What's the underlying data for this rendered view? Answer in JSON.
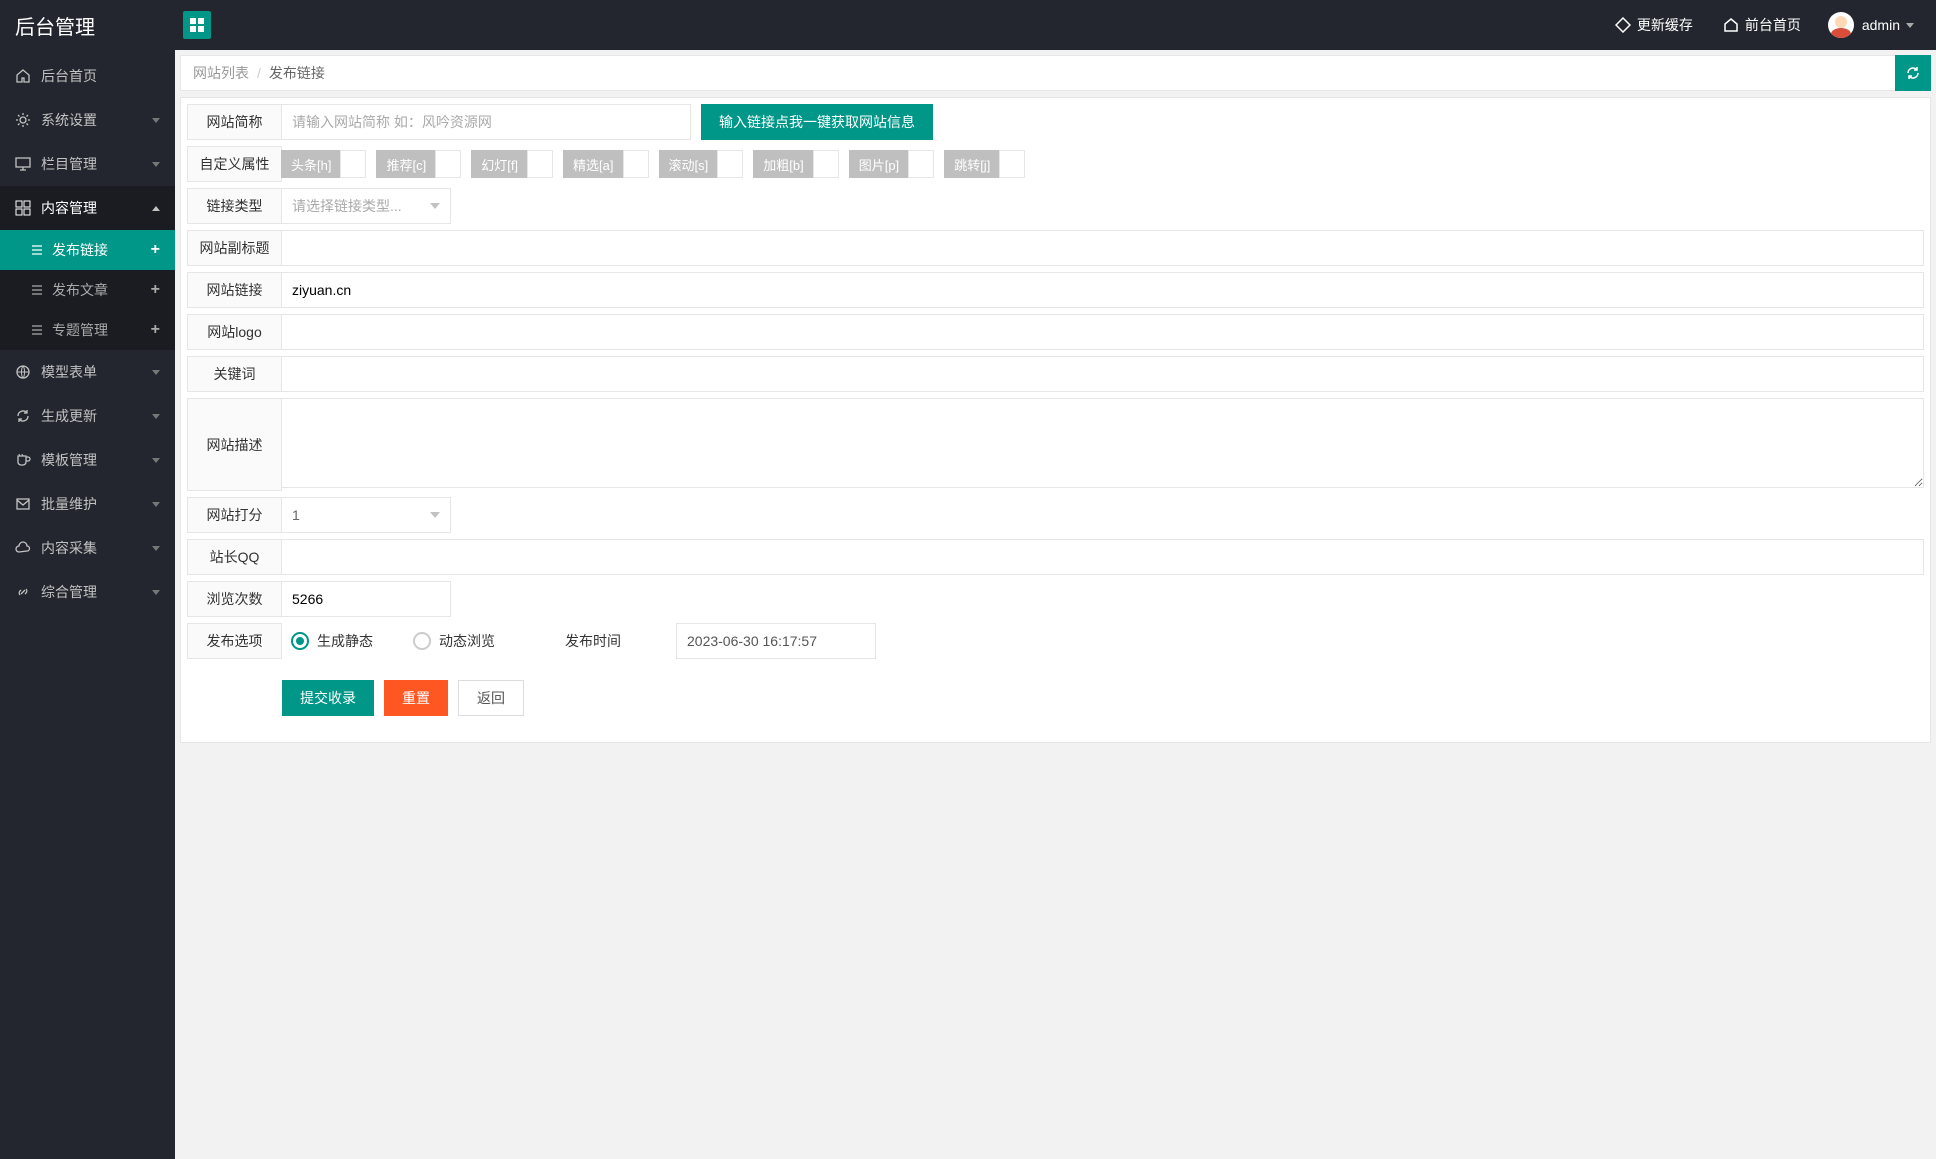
{
  "header": {
    "title": "后台管理",
    "refresh_cache": "更新缓存",
    "frontend_home": "前台首页",
    "user": "admin"
  },
  "sidebar": {
    "items": [
      {
        "label": "后台首页",
        "icon": "home",
        "expandable": false
      },
      {
        "label": "系统设置",
        "icon": "gear",
        "expandable": true
      },
      {
        "label": "栏目管理",
        "icon": "monitor",
        "expandable": true
      },
      {
        "label": "内容管理",
        "icon": "grid",
        "expandable": true,
        "open": true,
        "children": [
          {
            "label": "发布链接",
            "active": true
          },
          {
            "label": "发布文章",
            "active": false
          },
          {
            "label": "专题管理",
            "active": false
          }
        ]
      },
      {
        "label": "模型表单",
        "icon": "globe",
        "expandable": true
      },
      {
        "label": "生成更新",
        "icon": "refresh",
        "expandable": true
      },
      {
        "label": "模板管理",
        "icon": "cup",
        "expandable": true
      },
      {
        "label": "批量维护",
        "icon": "mail",
        "expandable": true
      },
      {
        "label": "内容采集",
        "icon": "cloud",
        "expandable": true
      },
      {
        "label": "综合管理",
        "icon": "link",
        "expandable": true
      }
    ]
  },
  "breadcrumb": {
    "parent": "网站列表",
    "current": "发布链接"
  },
  "form": {
    "site_name": {
      "label": "网站简称",
      "placeholder": "请输入网站简称 如：风吟资源网",
      "value": "",
      "fetch_btn": "输入链接点我一键获取网站信息"
    },
    "custom_attr": {
      "label": "自定义属性",
      "tags": [
        "头条[h]",
        "推荐[c]",
        "幻灯[f]",
        "精选[a]",
        "滚动[s]",
        "加粗[b]",
        "图片[p]",
        "跳转[j]"
      ]
    },
    "link_type": {
      "label": "链接类型",
      "placeholder": "请选择链接类型..."
    },
    "subtitle": {
      "label": "网站副标题",
      "value": ""
    },
    "site_link": {
      "label": "网站链接",
      "value": "ziyuan.cn"
    },
    "site_logo": {
      "label": "网站logo",
      "value": ""
    },
    "keywords": {
      "label": "关键词",
      "value": ""
    },
    "description": {
      "label": "网站描述",
      "value": ""
    },
    "rating": {
      "label": "网站打分",
      "value": "1"
    },
    "webmaster_qq": {
      "label": "站长QQ",
      "value": ""
    },
    "views": {
      "label": "浏览次数",
      "value": "5266"
    },
    "publish": {
      "label": "发布选项",
      "option_static": "生成静态",
      "option_dynamic": "动态浏览",
      "time_label": "发布时间",
      "time_value": "2023-06-30 16:17:57"
    }
  },
  "actions": {
    "submit": "提交收录",
    "reset": "重置",
    "back": "返回"
  }
}
